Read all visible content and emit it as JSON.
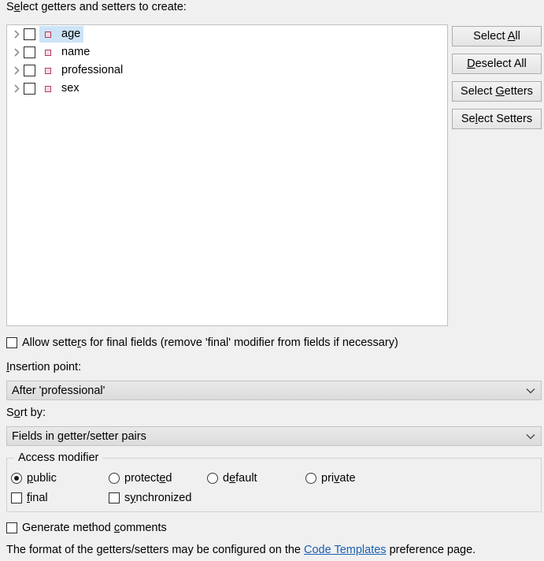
{
  "header": {
    "tree_label_pre": "S",
    "tree_label_mnemonic": "e",
    "tree_label_post": "lect getters and setters to create:",
    "tree_label_full": "Select getters and setters to create:"
  },
  "tree": {
    "items": [
      {
        "label": "age",
        "icon": "private-field-icon",
        "checked": false,
        "selected": true,
        "expandable": true
      },
      {
        "label": "name",
        "icon": "private-field-icon",
        "checked": false,
        "selected": false,
        "expandable": true
      },
      {
        "label": "professional",
        "icon": "private-field-icon",
        "checked": false,
        "selected": false,
        "expandable": true
      },
      {
        "label": "sex",
        "icon": "private-field-icon",
        "checked": false,
        "selected": false,
        "expandable": true
      }
    ],
    "selection_color": "#cde3f7",
    "icon_color": "#b9395f"
  },
  "buttons": [
    {
      "name": "select-all-button",
      "pre": "Select ",
      "mn": "A",
      "post": "ll"
    },
    {
      "name": "deselect-all-button",
      "pre": "",
      "mn": "D",
      "post": "eselect All"
    },
    {
      "name": "select-getters-button",
      "pre": "Select ",
      "mn": "G",
      "post": "etters"
    },
    {
      "name": "select-setters-button",
      "pre": "Se",
      "mn": "l",
      "post": "ect Setters"
    }
  ],
  "allow_setters": {
    "checked": false,
    "pre": "Allow sette",
    "mn": "r",
    "post": "s for final fields (remove 'final' modifier from fields if necessary)"
  },
  "insertion_point": {
    "label_pre": "",
    "label_mn": "I",
    "label_post": "nsertion point:",
    "value": "After 'professional'"
  },
  "sort_by": {
    "label_pre": "S",
    "label_mn": "o",
    "label_post": "rt by:",
    "value": "Fields in getter/setter pairs"
  },
  "access_modifier": {
    "legend": "Access modifier",
    "radios": [
      {
        "name": "radio-public",
        "pre": "",
        "mn": "p",
        "post": "ublic",
        "selected": true
      },
      {
        "name": "radio-protected",
        "pre": "protect",
        "mn": "e",
        "post": "d",
        "selected": false
      },
      {
        "name": "radio-default",
        "pre": "d",
        "mn": "e",
        "post": "fault",
        "selected": false
      },
      {
        "name": "radio-private",
        "pre": "pri",
        "mn": "v",
        "post": "ate",
        "selected": false
      }
    ],
    "checkboxes": [
      {
        "name": "checkbox-final",
        "pre": "",
        "mn": "f",
        "post": "inal",
        "checked": false
      },
      {
        "name": "checkbox-synchronized",
        "pre": "s",
        "mn": "y",
        "post": "nchronized",
        "checked": false
      }
    ]
  },
  "generate_comments": {
    "checked": false,
    "pre": "Generate method ",
    "mn": "c",
    "post": "omments"
  },
  "footer": {
    "text_before": "The format of the getters/setters may be configured on the ",
    "link_text": "Code Templates",
    "text_after": " preference page.",
    "link_color": "#1b5fb4"
  }
}
